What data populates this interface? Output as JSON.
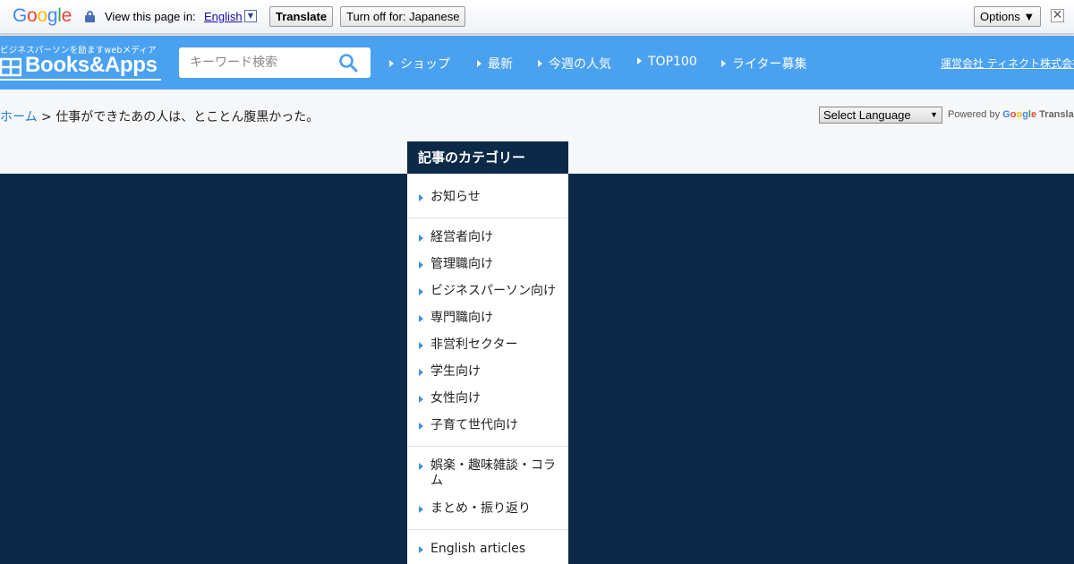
{
  "translate_bar": {
    "logo_letters": [
      "G",
      "o",
      "o",
      "g",
      "l",
      "e"
    ],
    "logo_colors": [
      "#4285f4",
      "#ea4335",
      "#fbbc05",
      "#4285f4",
      "#34a853",
      "#ea4335"
    ],
    "view_label": "View this page in:",
    "language": "English",
    "lang_arrow": "▼",
    "translate_button": "Translate",
    "turn_off_button": "Turn off for: Japanese",
    "options_button": "Options ▼",
    "close_glyph": "✕"
  },
  "header": {
    "tagline": "ビジネスパーソンを励ますwebメディア",
    "brand": "Books&Apps",
    "search_placeholder": "キーワード検索",
    "nav": [
      "ショップ",
      "最新",
      "今週の人気",
      "TOP100",
      "ライター募集"
    ],
    "company_link": "運営会社 ティネクト株式会社",
    "bg_color": "#4aa1f0"
  },
  "breadcrumb": {
    "home": "ホーム",
    "separator": " > ",
    "current": "仕事ができたあの人は、とことん腹黒かった。"
  },
  "language_widget": {
    "select_label": "Select Language",
    "powered_by": "Powered by",
    "google_word": "Google",
    "translate_word": "Translate"
  },
  "categories": {
    "title": "記事のカテゴリー",
    "items": [
      "お知らせ",
      "経営者向け",
      "管理職向け",
      "ビジネスパーソン向け",
      "専門職向け",
      "非営利セクター",
      "学生向け",
      "女性向け",
      "子育て世代向け",
      "娯楽・趣味雑談・コラム",
      "まとめ・振り返り",
      "English articles"
    ],
    "accent_color": "#0c2a47"
  }
}
